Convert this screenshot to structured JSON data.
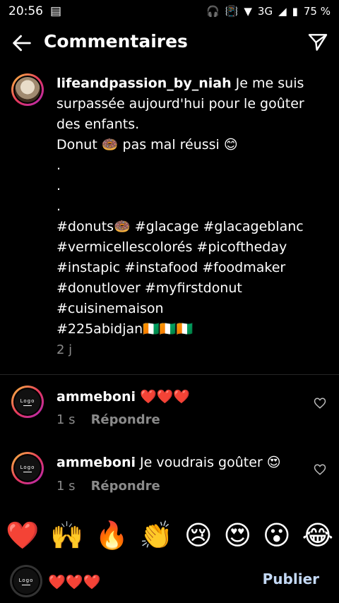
{
  "status": {
    "time": "20:56",
    "network": "3G",
    "battery": "75 %"
  },
  "header": {
    "title": "Commentaires"
  },
  "caption": {
    "username": "lifeandpassion_by_niah",
    "text": " Je me suis surpassée aujourd'hui pour le goûter des enfants.\nDonut 🍩 pas mal réussi 😊\n.\n.\n.\n#donuts🍩 #glacage #glacageblanc #vermicellescolorés #picoftheday #instapic #instafood #foodmaker #donutlover #myfirstdonut #cuisinemaison\n#225abidjan🇨🇮🇨🇮🇨🇮",
    "time": "2 j"
  },
  "comments": [
    {
      "username": "ammeboni",
      "text": " ❤️❤️❤️",
      "time": "1 s",
      "reply": "Répondre"
    },
    {
      "username": "ammeboni",
      "text": " Je voudrais goûter 😍",
      "time": "1 s",
      "reply": "Répondre"
    }
  ],
  "avatar_logo": "Logo",
  "emoji_bar": [
    "❤️",
    "🙌",
    "🔥",
    "👏",
    "😢",
    "😍",
    "😮",
    "😂"
  ],
  "composer": {
    "value": "❤️❤️❤️",
    "publish": "Publier"
  }
}
